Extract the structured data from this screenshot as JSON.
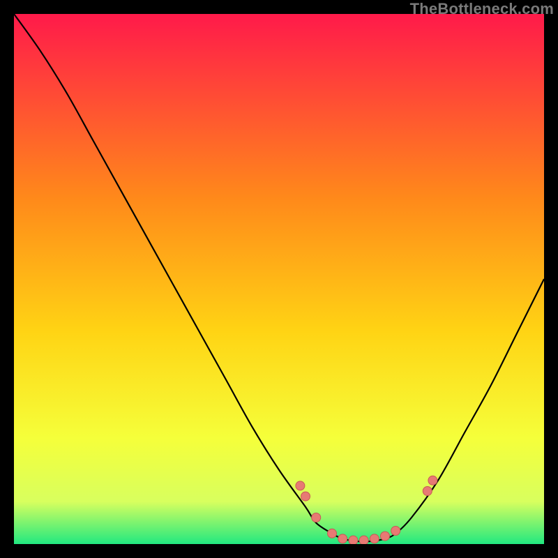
{
  "watermark": "TheBottleneck.com",
  "colors": {
    "frame_bg": "#000000",
    "gradient_top": "#ff1a4a",
    "gradient_mid1": "#ffa018",
    "gradient_mid2": "#ffe712",
    "gradient_mid3": "#f8ff60",
    "gradient_bottom": "#21e880",
    "curve": "#000000",
    "marker_fill": "#e77a74",
    "marker_stroke": "#c85a54"
  },
  "chart_data": {
    "type": "line",
    "title": "",
    "xlabel": "",
    "ylabel": "",
    "xlim": [
      0,
      100
    ],
    "ylim": [
      0,
      100
    ],
    "grid": false,
    "legend": false,
    "series": [
      {
        "name": "bottleneck-curve",
        "x": [
          0,
          5,
          10,
          15,
          20,
          25,
          30,
          35,
          40,
          45,
          50,
          55,
          57,
          60,
          62,
          65,
          67,
          70,
          72,
          75,
          80,
          85,
          90,
          95,
          100
        ],
        "y": [
          100,
          93,
          85,
          76,
          67,
          58,
          49,
          40,
          31,
          22,
          14,
          7,
          4,
          2,
          1,
          0.5,
          0.5,
          1,
          2,
          5,
          12,
          21,
          30,
          40,
          50
        ]
      }
    ],
    "markers": {
      "name": "highlight-points",
      "x": [
        54,
        55,
        57,
        60,
        62,
        64,
        66,
        68,
        70,
        72,
        78,
        79
      ],
      "y": [
        11,
        9,
        5,
        2,
        1,
        0.7,
        0.7,
        1,
        1.5,
        2.5,
        10,
        12
      ]
    },
    "background_gradient_stops": [
      {
        "offset": 0.0,
        "color": "#ff1a4a"
      },
      {
        "offset": 0.35,
        "color": "#ff8a1a"
      },
      {
        "offset": 0.6,
        "color": "#ffd414"
      },
      {
        "offset": 0.8,
        "color": "#f5ff3a"
      },
      {
        "offset": 0.92,
        "color": "#d8ff5e"
      },
      {
        "offset": 1.0,
        "color": "#21e880"
      }
    ]
  }
}
